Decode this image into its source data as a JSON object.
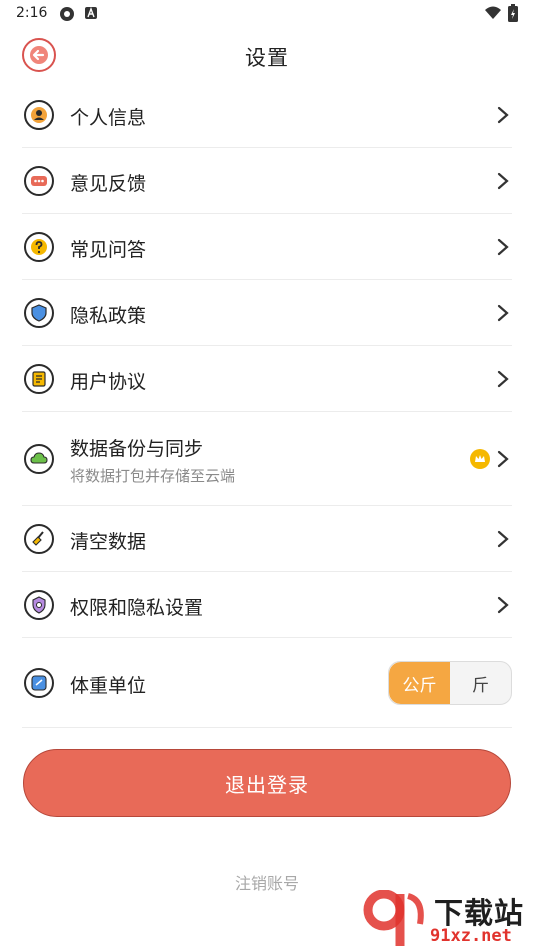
{
  "status_bar": {
    "time": "2:16"
  },
  "header": {
    "title": "设置"
  },
  "settings": [
    {
      "label": "个人信息"
    },
    {
      "label": "意见反馈"
    },
    {
      "label": "常见问答"
    },
    {
      "label": "隐私政策"
    },
    {
      "label": "用户协议"
    },
    {
      "label": "数据备份与同步",
      "sublabel": "将数据打包并存储至云端"
    },
    {
      "label": "清空数据"
    },
    {
      "label": "权限和隐私设置"
    }
  ],
  "weight_unit": {
    "label": "体重单位",
    "options": [
      "公斤",
      "斤"
    ],
    "selected": "公斤"
  },
  "logout": {
    "label": "退出登录"
  },
  "cancel_account": {
    "label": "注销账号"
  },
  "watermark": {
    "big": "下载站",
    "small": "91xz.net"
  },
  "colors": {
    "accent": "#e86a58",
    "toggle_active": "#f5a742",
    "crown": "#f5b800"
  }
}
